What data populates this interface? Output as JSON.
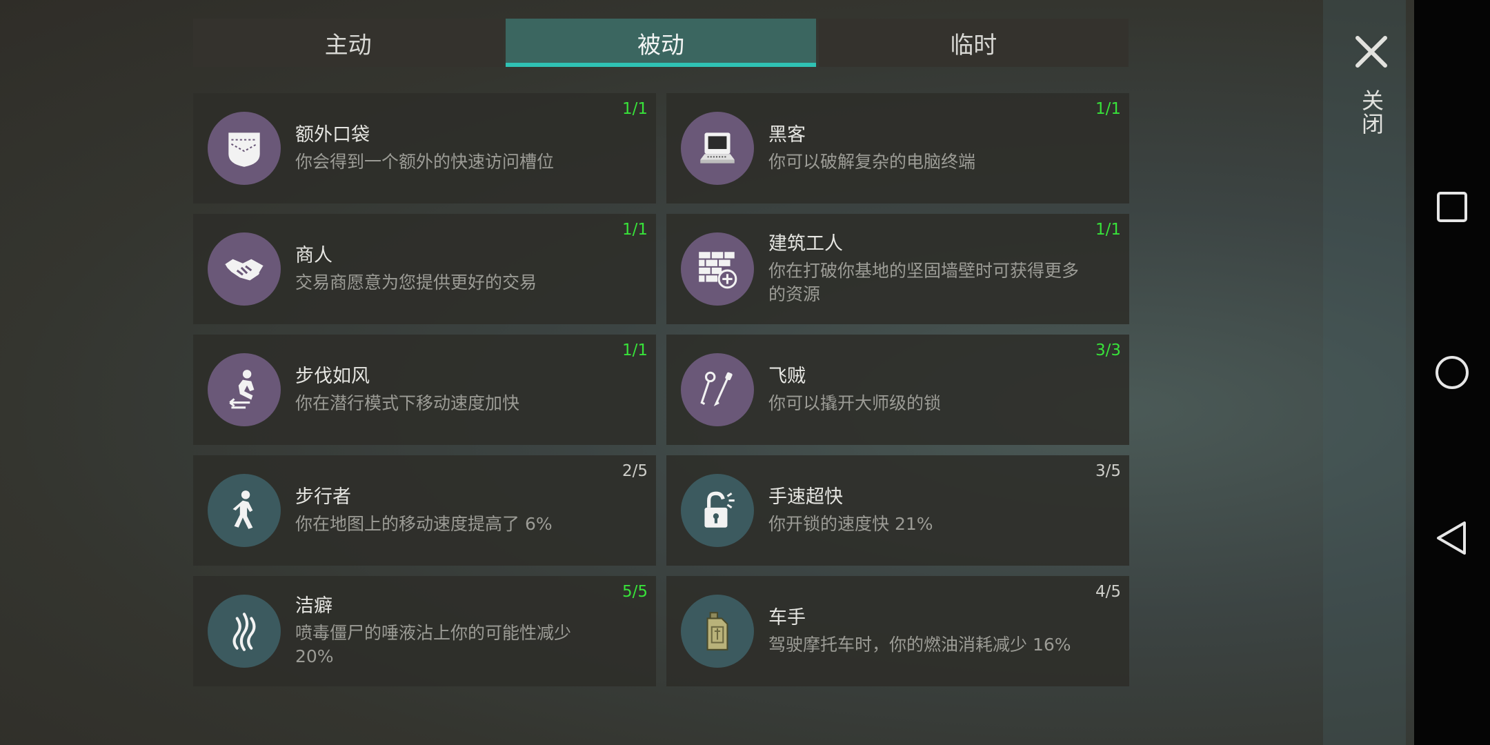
{
  "tabs": [
    {
      "label": "主动",
      "active": false
    },
    {
      "label": "被动",
      "active": true
    },
    {
      "label": "临时",
      "active": false
    }
  ],
  "close_label": "关闭",
  "colors": {
    "accent": "#2fc2b4",
    "active_tab": "#3b6660",
    "maxed_count": "#38e23a",
    "icon_purple": "#6a5878",
    "icon_teal": "#3c5a5f"
  },
  "skills": [
    {
      "title": "额外口袋",
      "desc": "你会得到一个额外的快速访问槽位",
      "count": "1/1",
      "maxed": true,
      "icon": "pocket-icon"
    },
    {
      "title": "黑客",
      "desc": "你可以破解复杂的电脑终端",
      "count": "1/1",
      "maxed": true,
      "icon": "computer-terminal-icon"
    },
    {
      "title": "商人",
      "desc": "交易商愿意为您提供更好的交易",
      "count": "1/1",
      "maxed": true,
      "icon": "handshake-icon"
    },
    {
      "title": "建筑工人",
      "desc": "你在打破你基地的坚固墙壁时可获得更多的资源",
      "count": "1/1",
      "maxed": true,
      "icon": "brick-wall-plus-icon"
    },
    {
      "title": "步伐如风",
      "desc": "你在潜行模式下移动速度加快",
      "count": "1/1",
      "maxed": true,
      "icon": "sneaking-figure-icon"
    },
    {
      "title": "飞贼",
      "desc": "你可以撬开大师级的锁",
      "count": "3/3",
      "maxed": true,
      "icon": "lockpick-icon"
    },
    {
      "title": "步行者",
      "desc": "你在地图上的移动速度提高了 6%",
      "count": "2/5",
      "maxed": false,
      "icon": "walking-person-icon"
    },
    {
      "title": "手速超快",
      "desc": "你开锁的速度快 21%",
      "count": "3/5",
      "maxed": false,
      "icon": "open-padlock-icon"
    },
    {
      "title": "洁癖",
      "desc": "喷毒僵尸的唾液沾上你的可能性减少 20%",
      "count": "5/5",
      "maxed": true,
      "icon": "fumes-icon"
    },
    {
      "title": "车手",
      "desc": "驾驶摩托车时，你的燃油消耗减少 16%",
      "count": "4/5",
      "maxed": false,
      "icon": "fuel-canister-icon"
    }
  ]
}
